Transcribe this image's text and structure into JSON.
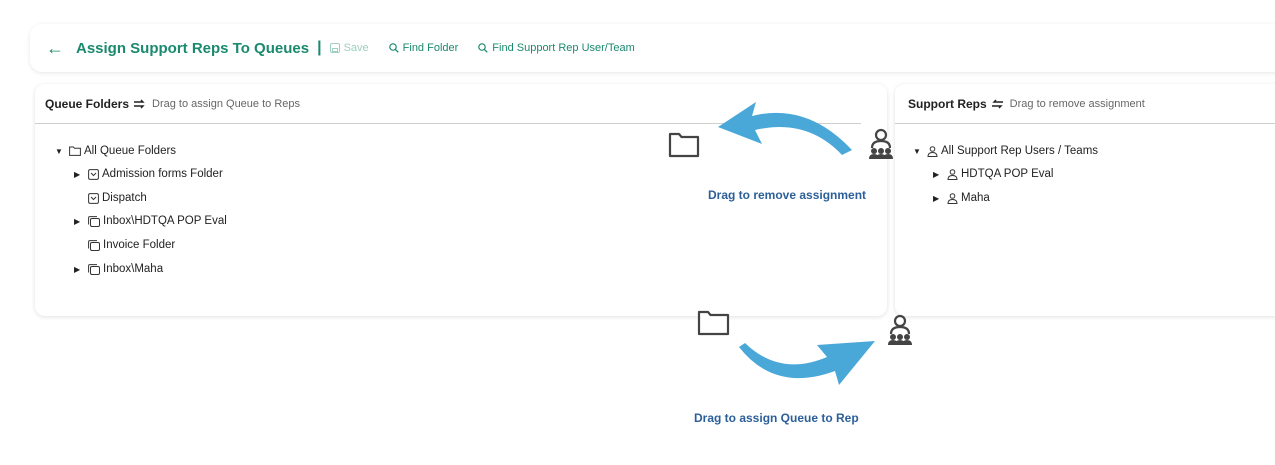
{
  "toolbar": {
    "title": "Assign Support Reps To Queues",
    "separator": "|",
    "save_label": "Save",
    "find_folder_label": "Find Folder",
    "find_rep_label": "Find Support Rep User/Team",
    "accent": "#1a8a6e"
  },
  "left_panel": {
    "title": "Queue Folders",
    "hint": "Drag to assign Queue to Reps",
    "tree": {
      "root": "All Queue Folders",
      "items": [
        {
          "label": "Admission forms Folder",
          "icon": "inbox-folder-icon",
          "expandable": true
        },
        {
          "label": "Dispatch",
          "icon": "inbox-folder-icon",
          "expandable": false
        },
        {
          "label": "Inbox\\HDTQA POP Eval",
          "icon": "stacked-folder-icon",
          "expandable": true
        },
        {
          "label": "Invoice Folder",
          "icon": "stacked-folder-icon",
          "expandable": false
        },
        {
          "label": "Inbox\\Maha",
          "icon": "stacked-folder-icon",
          "expandable": true
        }
      ]
    }
  },
  "right_panel": {
    "title": "Support Reps",
    "hint": "Drag to remove assignment",
    "tree": {
      "root": "All Support Rep Users / Teams",
      "items": [
        {
          "label": "HDTQA POP Eval",
          "icon": "team-icon",
          "expandable": true
        },
        {
          "label": "Maha",
          "icon": "team-icon",
          "expandable": true
        }
      ]
    }
  },
  "annotations": {
    "remove_caption": "Drag to remove assignment",
    "assign_caption": "Drag to assign Queue to Rep",
    "arrow_color": "#4aa8d8",
    "caption_color": "#2c5f9a"
  }
}
